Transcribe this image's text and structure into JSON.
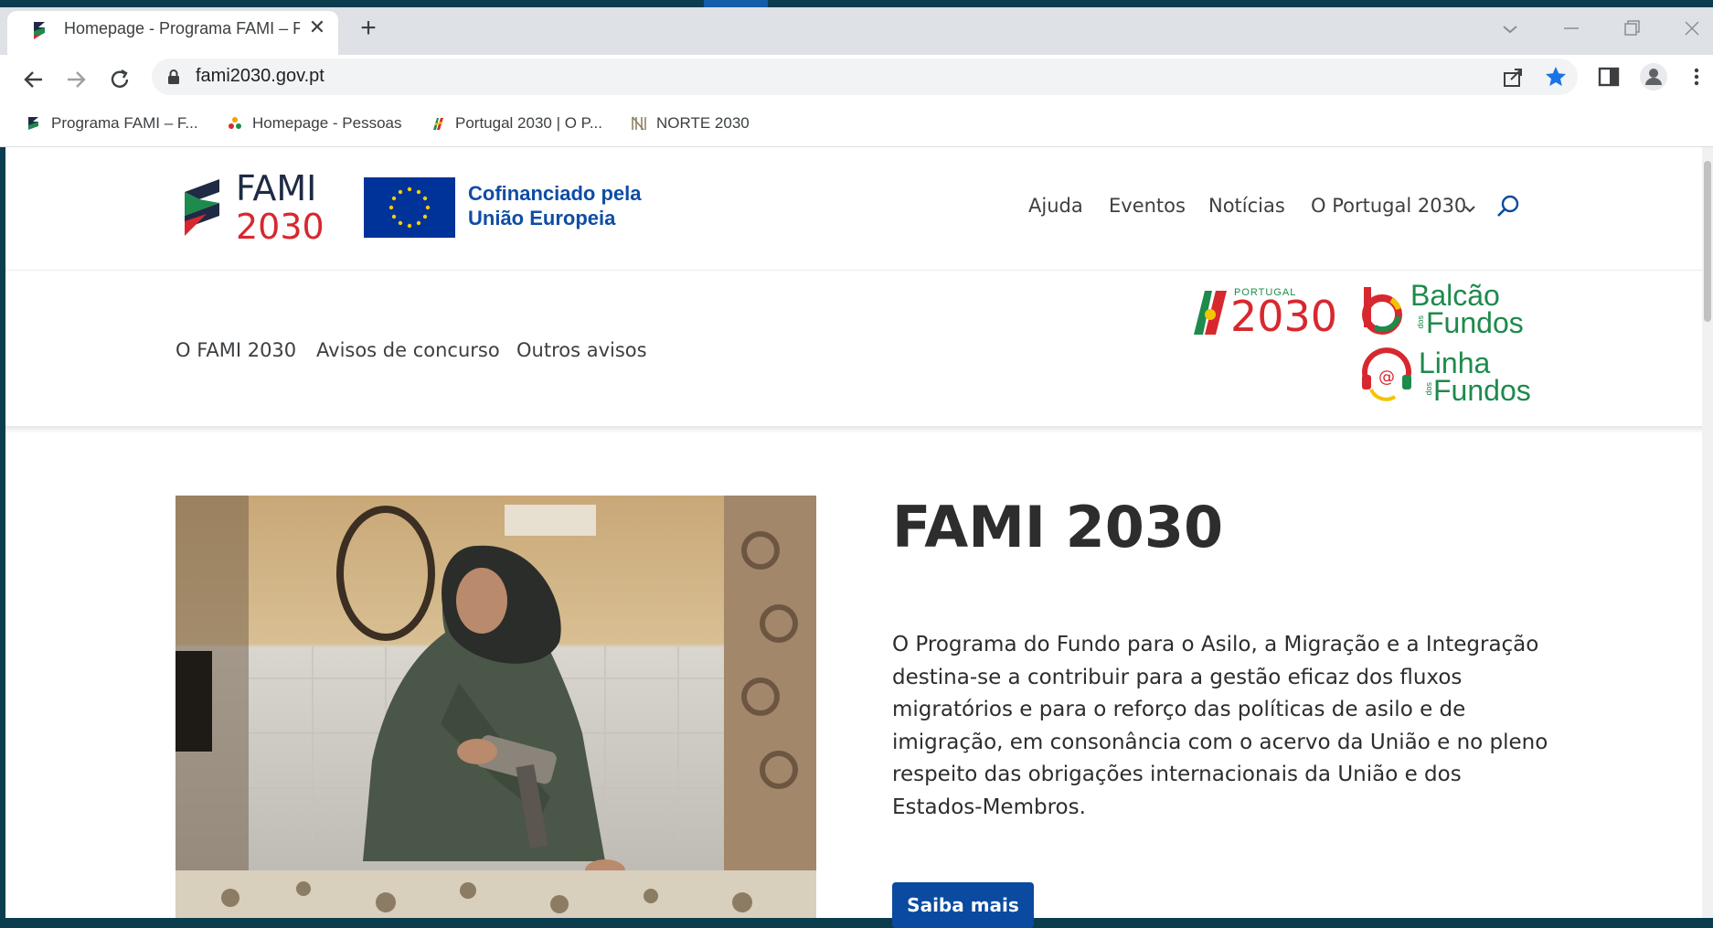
{
  "browser": {
    "tab_title": "Homepage - Programa FAMI – Fundo",
    "tab_close": "✕",
    "new_tab": "+",
    "url": "fami2030.gov.pt",
    "bookmarks": [
      {
        "label": "Programa FAMI – F..."
      },
      {
        "label": "Homepage - Pessoas"
      },
      {
        "label": "Portugal 2030 | O P..."
      },
      {
        "label": "NORTE 2030"
      }
    ]
  },
  "header": {
    "logo_fami": "FAMI",
    "logo_year": "2030",
    "eu_line1": "Cofinanciado pela",
    "eu_line2": "União Europeia",
    "nav": [
      "Ajuda",
      "Eventos",
      "Notícias",
      "O Portugal 2030"
    ]
  },
  "subnav": {
    "items": [
      "O FAMI 2030",
      "Avisos de concurso",
      "Outros avisos"
    ],
    "pt2030_small": "PORTUGAL",
    "pt2030_year": "2030",
    "balcao_line1": "Balcão",
    "balcao_dos": "dos",
    "balcao_line2": "Fundos",
    "linha_line1": "Linha",
    "linha_dos": "dos",
    "linha_line2": "Fundos"
  },
  "hero": {
    "title": "FAMI 2030",
    "paragraph": "O Programa do Fundo para o Asilo, a Migração e a Integração destina-se a contribuir para a gestão eficaz dos fluxos migratórios e para o reforço das políticas de asilo e de imigração, em consonância com o acervo da União e no pleno respeito das obrigações internacionais da União e dos Estados-Membros.",
    "button": "Saiba mais"
  },
  "colors": {
    "fami_dark": "#1f2a44",
    "fami_red": "#d7282f",
    "eu_blue": "#003399",
    "eu_yellow": "#ffcc00",
    "button_blue": "#0a4aa0",
    "pt_green": "#1e8a4c",
    "pt_red": "#d7282f"
  },
  "icons": [
    "back-icon",
    "forward-icon",
    "reload-icon",
    "lock-icon",
    "share-icon",
    "star-icon",
    "side-panel-icon",
    "profile-icon",
    "menu-icon",
    "search-icon",
    "chevron-down-icon"
  ]
}
